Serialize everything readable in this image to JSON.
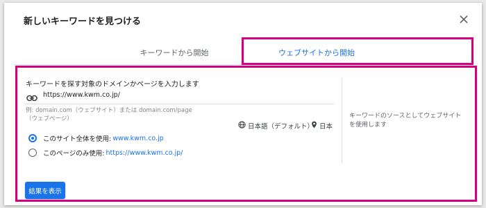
{
  "dialog": {
    "title": "新しいキーワードを見つける",
    "close_icon": "close-icon"
  },
  "tabs": [
    {
      "label": "キーワードから開始",
      "selected": false
    },
    {
      "label": "ウェブサイトから開始",
      "selected": true
    }
  ],
  "form": {
    "prompt": "キーワードを探す対象のドメインかページを入力します",
    "url_value": "https://www.kwm.co.jp/",
    "link_icon": "link-icon",
    "hint": "例: domain.com（ウェブサイト）または domain.com/page（ウェブページ）",
    "language": "日本語（デフォルト）",
    "language_icon": "globe-icon",
    "location": "日本",
    "location_icon": "location-pin-icon"
  },
  "options": [
    {
      "label": "このサイト全体を使用:",
      "url": "www.kwm.co.jp",
      "selected": true
    },
    {
      "label": "このページのみ使用:",
      "url": "https://www.kwm.co.jp/",
      "selected": false
    }
  ],
  "side_note": "キーワードのソースとしてウェブサイトを使用します",
  "submit_label": "結果を表示",
  "colors": {
    "accent": "#1a73e8",
    "highlight": "#d4007f"
  }
}
